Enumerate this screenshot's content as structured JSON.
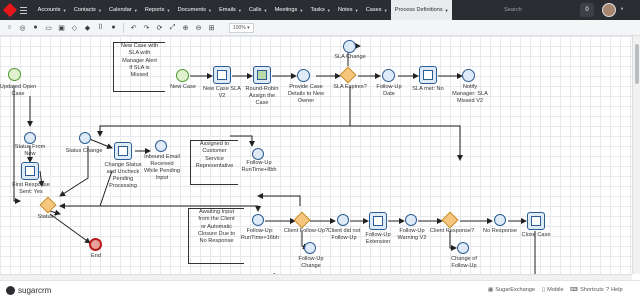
{
  "nav": {
    "items": [
      {
        "label": "Accounts"
      },
      {
        "label": "Contacts"
      },
      {
        "label": "Calendar"
      },
      {
        "label": "Reports"
      },
      {
        "label": "Documents"
      },
      {
        "label": "Emails"
      },
      {
        "label": "Calls"
      },
      {
        "label": "Meetings"
      },
      {
        "label": "Tasks"
      },
      {
        "label": "Notes"
      },
      {
        "label": "Cases"
      },
      {
        "label": "Process Definitions"
      }
    ],
    "search_placeholder": "Search",
    "notification_count": "0",
    "colors": {
      "bar": "#2b2d33",
      "logo": "#e61718",
      "active_tab": "#e9ebee"
    }
  },
  "toolbar": {
    "zoom": "100%",
    "icons": [
      "start-event-icon",
      "intermediate-event-icon",
      "end-event-icon",
      "task-icon",
      "subprocess-icon",
      "gateway-icon",
      "data-icon",
      "annotation-icon",
      "comment-icon",
      "undo-icon",
      "redo-icon",
      "refresh-icon",
      "fit-icon",
      "zoom-in-icon",
      "zoom-out-icon",
      "grid-icon"
    ]
  },
  "diagram": {
    "annotations": {
      "a1": "New Case with\nSLA with\nManager Alert\nif SLA is\nMissed",
      "a2": "Assigned to\nCustomer\nService\nRepresentative",
      "a3": "Awaiting Input\nfrom the Client\nor Automatic\nClosure Due to\nNo Response"
    },
    "labels": {
      "updated_open_case": "Updated Open\nCase",
      "new_case": "New Case",
      "new_case_sla": "New Case SLA\nV2",
      "round_robin": "Round-Robin\nAssign the\nCase",
      "provide_details": "Provide Case\nDetails to New\nOwner",
      "sla_change": "SLA Change",
      "sla_expires": "SLA Expires?",
      "follow_up_date": "Follow-Up\nDate",
      "sla_met_no": "SLA met: No",
      "notify_manager": "Notify\nManager: SLA\nMissed V2",
      "status_from_new": "Status From\nNew",
      "status_change": "Status Change",
      "change_status": "Change Status\nand Uncheck\nPending\nProcessing",
      "inbound_email": "Inbound Email\nReceived\nWhile Pending\nInput",
      "follow_up_runtime": "Follow-Up\nRunTime+8bh",
      "first_response": "First Response\nSent: Yes",
      "status": "Status?",
      "end": "End",
      "follow_up_16": "Follow-Up:\nRunTime+16bh",
      "client_follow_up": "Client Follow-Up?",
      "client_did_not": "Client did not\nFollow-Up",
      "follow_up_ext": "Follow-Up\nExtension",
      "follow_up_warning": "Follow-Up\nWarning V2",
      "client_response": "Client Response?",
      "no_response": "No Response",
      "close_case": "Close Case",
      "follow_up_change": "Follow-Up\nChange",
      "change_of_follow_up": "Change of\nFollow-Up"
    }
  },
  "footer": {
    "brand": "sugarcrm",
    "items": [
      "SugarExchange",
      "Mobile",
      "Shortcuts",
      "Help"
    ]
  }
}
